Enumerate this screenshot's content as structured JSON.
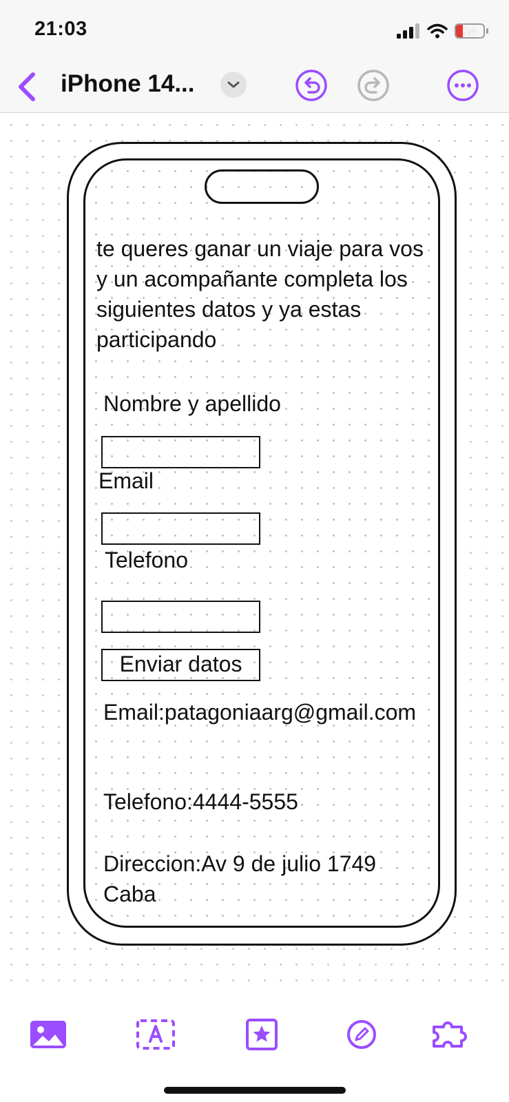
{
  "status_bar": {
    "time": "21:03",
    "battery_level": "14",
    "icons": [
      "signal-icon",
      "wifi-icon",
      "battery-icon"
    ]
  },
  "nav": {
    "title": "iPhone 14...",
    "icons": [
      "back-chevron-icon",
      "dropdown-chevron-icon",
      "undo-icon",
      "redo-icon",
      "more-icon"
    ]
  },
  "mockup": {
    "intro_text": "te queres ganar un viaje para vos y un acompañante completa los siguientes datos y ya estas participando",
    "form": {
      "name_label": "Nombre y apellido",
      "name_value": "",
      "email_label": "Email",
      "email_value": "",
      "phone_label": "Telefono",
      "phone_value": "",
      "submit_label": "Enviar datos"
    },
    "contact": {
      "email": "Email:patagoniaarg@gmail.com",
      "phone": "Telefono:4444-5555",
      "address": "Direccion:Av 9 de julio 1749 Caba"
    }
  },
  "toolbar": {
    "items": [
      "image-icon",
      "text-box-icon",
      "shape-star-icon",
      "pencil-icon",
      "puzzle-icon"
    ]
  },
  "colors": {
    "accent": "#9b4dff",
    "disabled": "#b8b8b8",
    "battery_low": "#e53935"
  }
}
